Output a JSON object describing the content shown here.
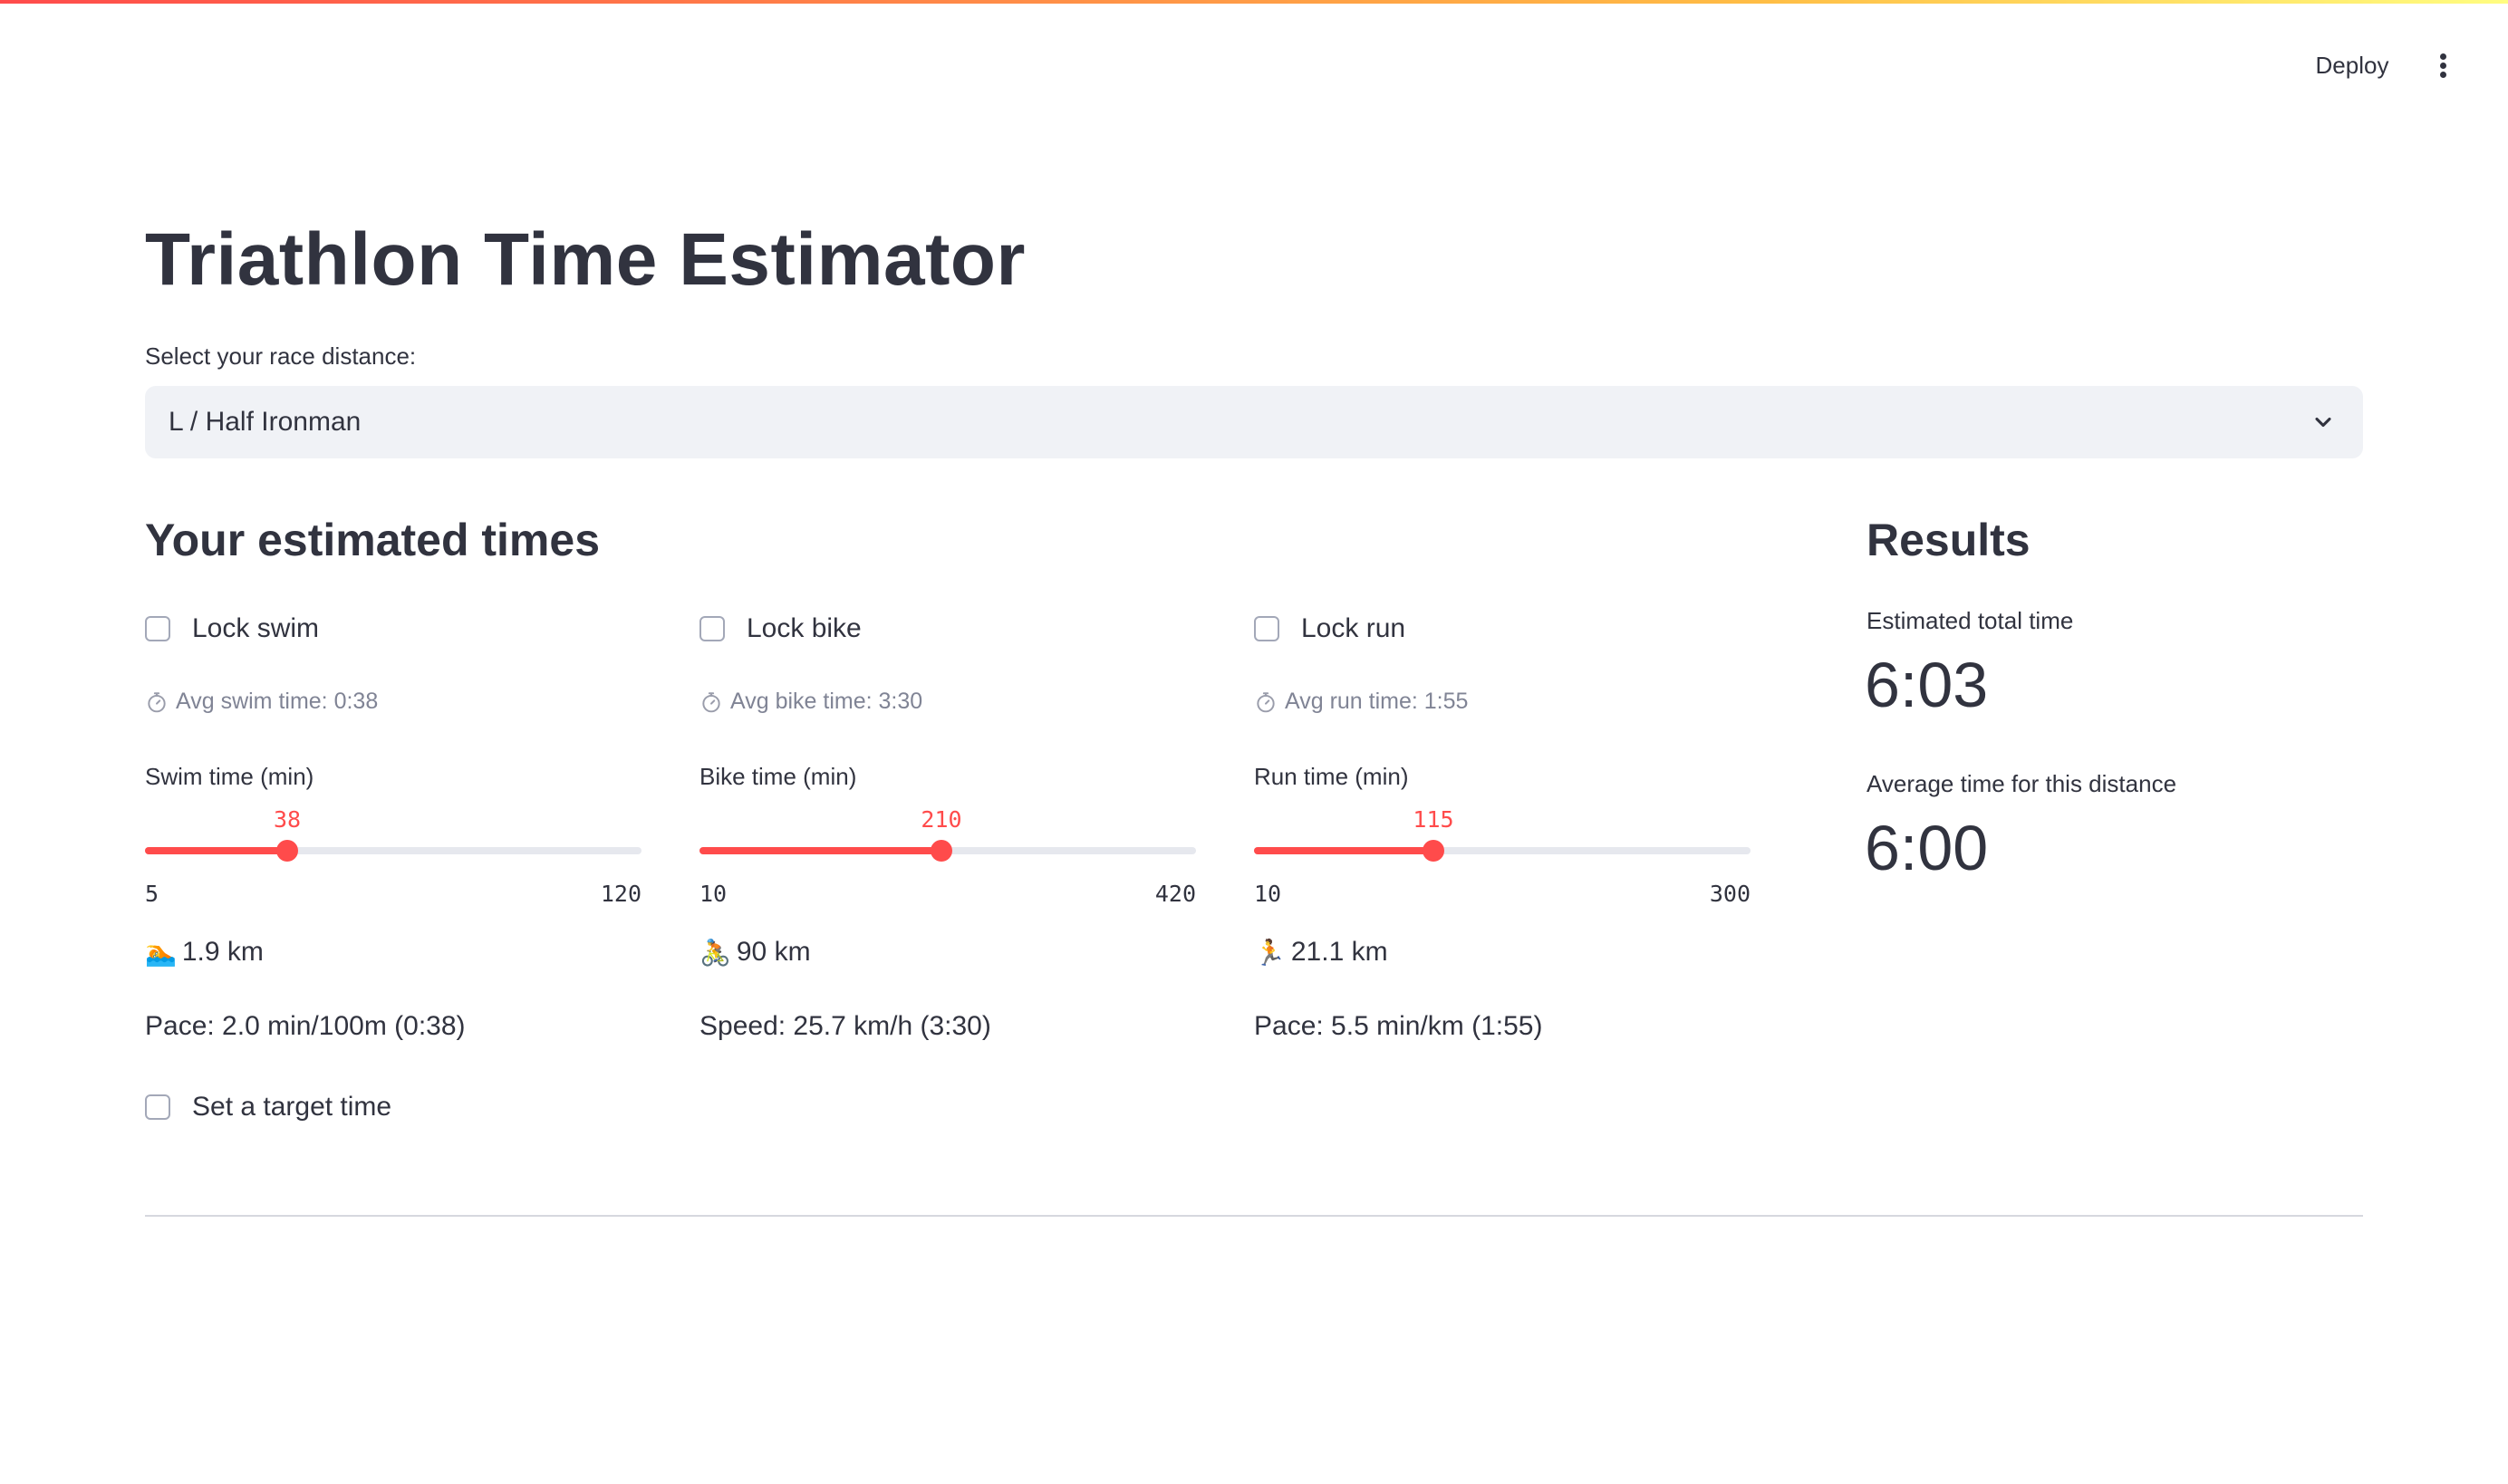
{
  "header": {
    "deploy_label": "Deploy",
    "menu_icon": "kebab-menu-icon"
  },
  "page": {
    "title": "Triathlon Time Estimator"
  },
  "race_select": {
    "label": "Select your race distance:",
    "value": "L / Half Ironman",
    "icon": "chevron-down-icon"
  },
  "estimates": {
    "heading": "Your estimated times",
    "swim": {
      "lock_label": "Lock swim",
      "lock_checked": false,
      "avg_text": "Avg swim time: 0:38",
      "slider_label": "Swim time (min)",
      "value": 38,
      "min": 5,
      "max": 120,
      "value_text": "38",
      "min_text": "5",
      "max_text": "120",
      "emoji": "🏊",
      "distance": "1.9 km",
      "pace": "Pace: 2.0 min/100m (0:38)"
    },
    "bike": {
      "lock_label": "Lock bike",
      "lock_checked": false,
      "avg_text": "Avg bike time: 3:30",
      "slider_label": "Bike time (min)",
      "value": 210,
      "min": 10,
      "max": 420,
      "value_text": "210",
      "min_text": "10",
      "max_text": "420",
      "emoji": "🚴",
      "distance": "90 km",
      "pace": "Speed: 25.7 km/h (3:30)"
    },
    "run": {
      "lock_label": "Lock run",
      "lock_checked": false,
      "avg_text": "Avg run time: 1:55",
      "slider_label": "Run time (min)",
      "value": 115,
      "min": 10,
      "max": 300,
      "value_text": "115",
      "min_text": "10",
      "max_text": "300",
      "emoji": "🏃",
      "distance": "21.1 km",
      "pace": "Pace: 5.5 min/km (1:55)"
    },
    "target_label": "Set a target time",
    "target_checked": false
  },
  "results": {
    "heading": "Results",
    "total_label": "Estimated total time",
    "total_value": "6:03",
    "average_label": "Average time for this distance",
    "average_value": "6:00"
  },
  "colors": {
    "accent": "#ff4b4b",
    "text": "#31333f",
    "muted": "#808495",
    "input_bg": "#f0f2f6"
  }
}
